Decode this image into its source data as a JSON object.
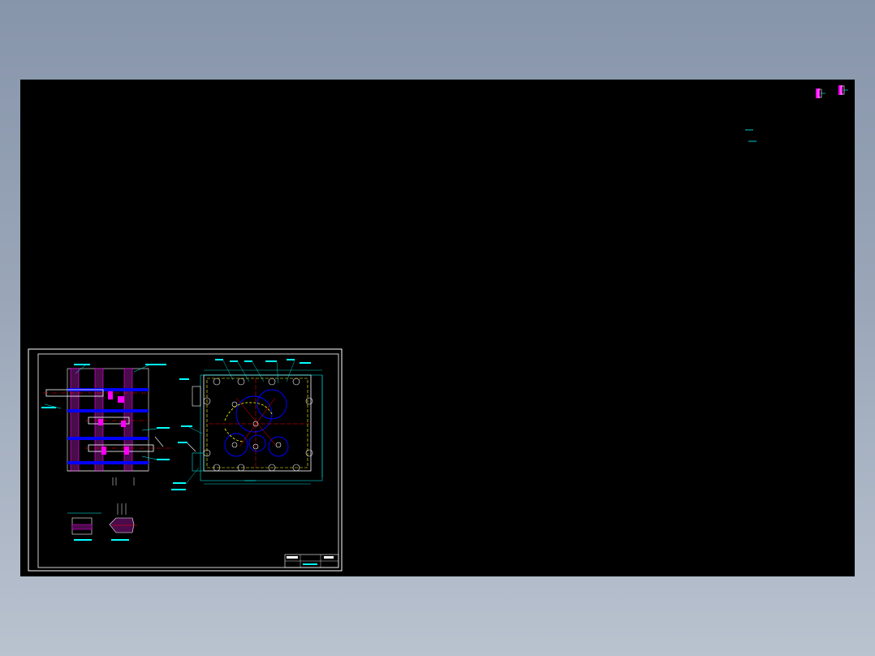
{
  "viewer": {
    "background": "#8f9bb0",
    "canvas_color": "#000000"
  },
  "drawing": {
    "frame_color": "#ffffff",
    "colors": {
      "cyan": "#00ffff",
      "yellow": "#ffff00",
      "magenta": "#ff00ff",
      "red": "#ff0000",
      "blue": "#0000ff",
      "white": "#ffffff",
      "green": "#00ff00"
    }
  },
  "top_right_icons": [
    {
      "name": "bolt-icon-1"
    },
    {
      "name": "bolt-icon-2"
    }
  ]
}
